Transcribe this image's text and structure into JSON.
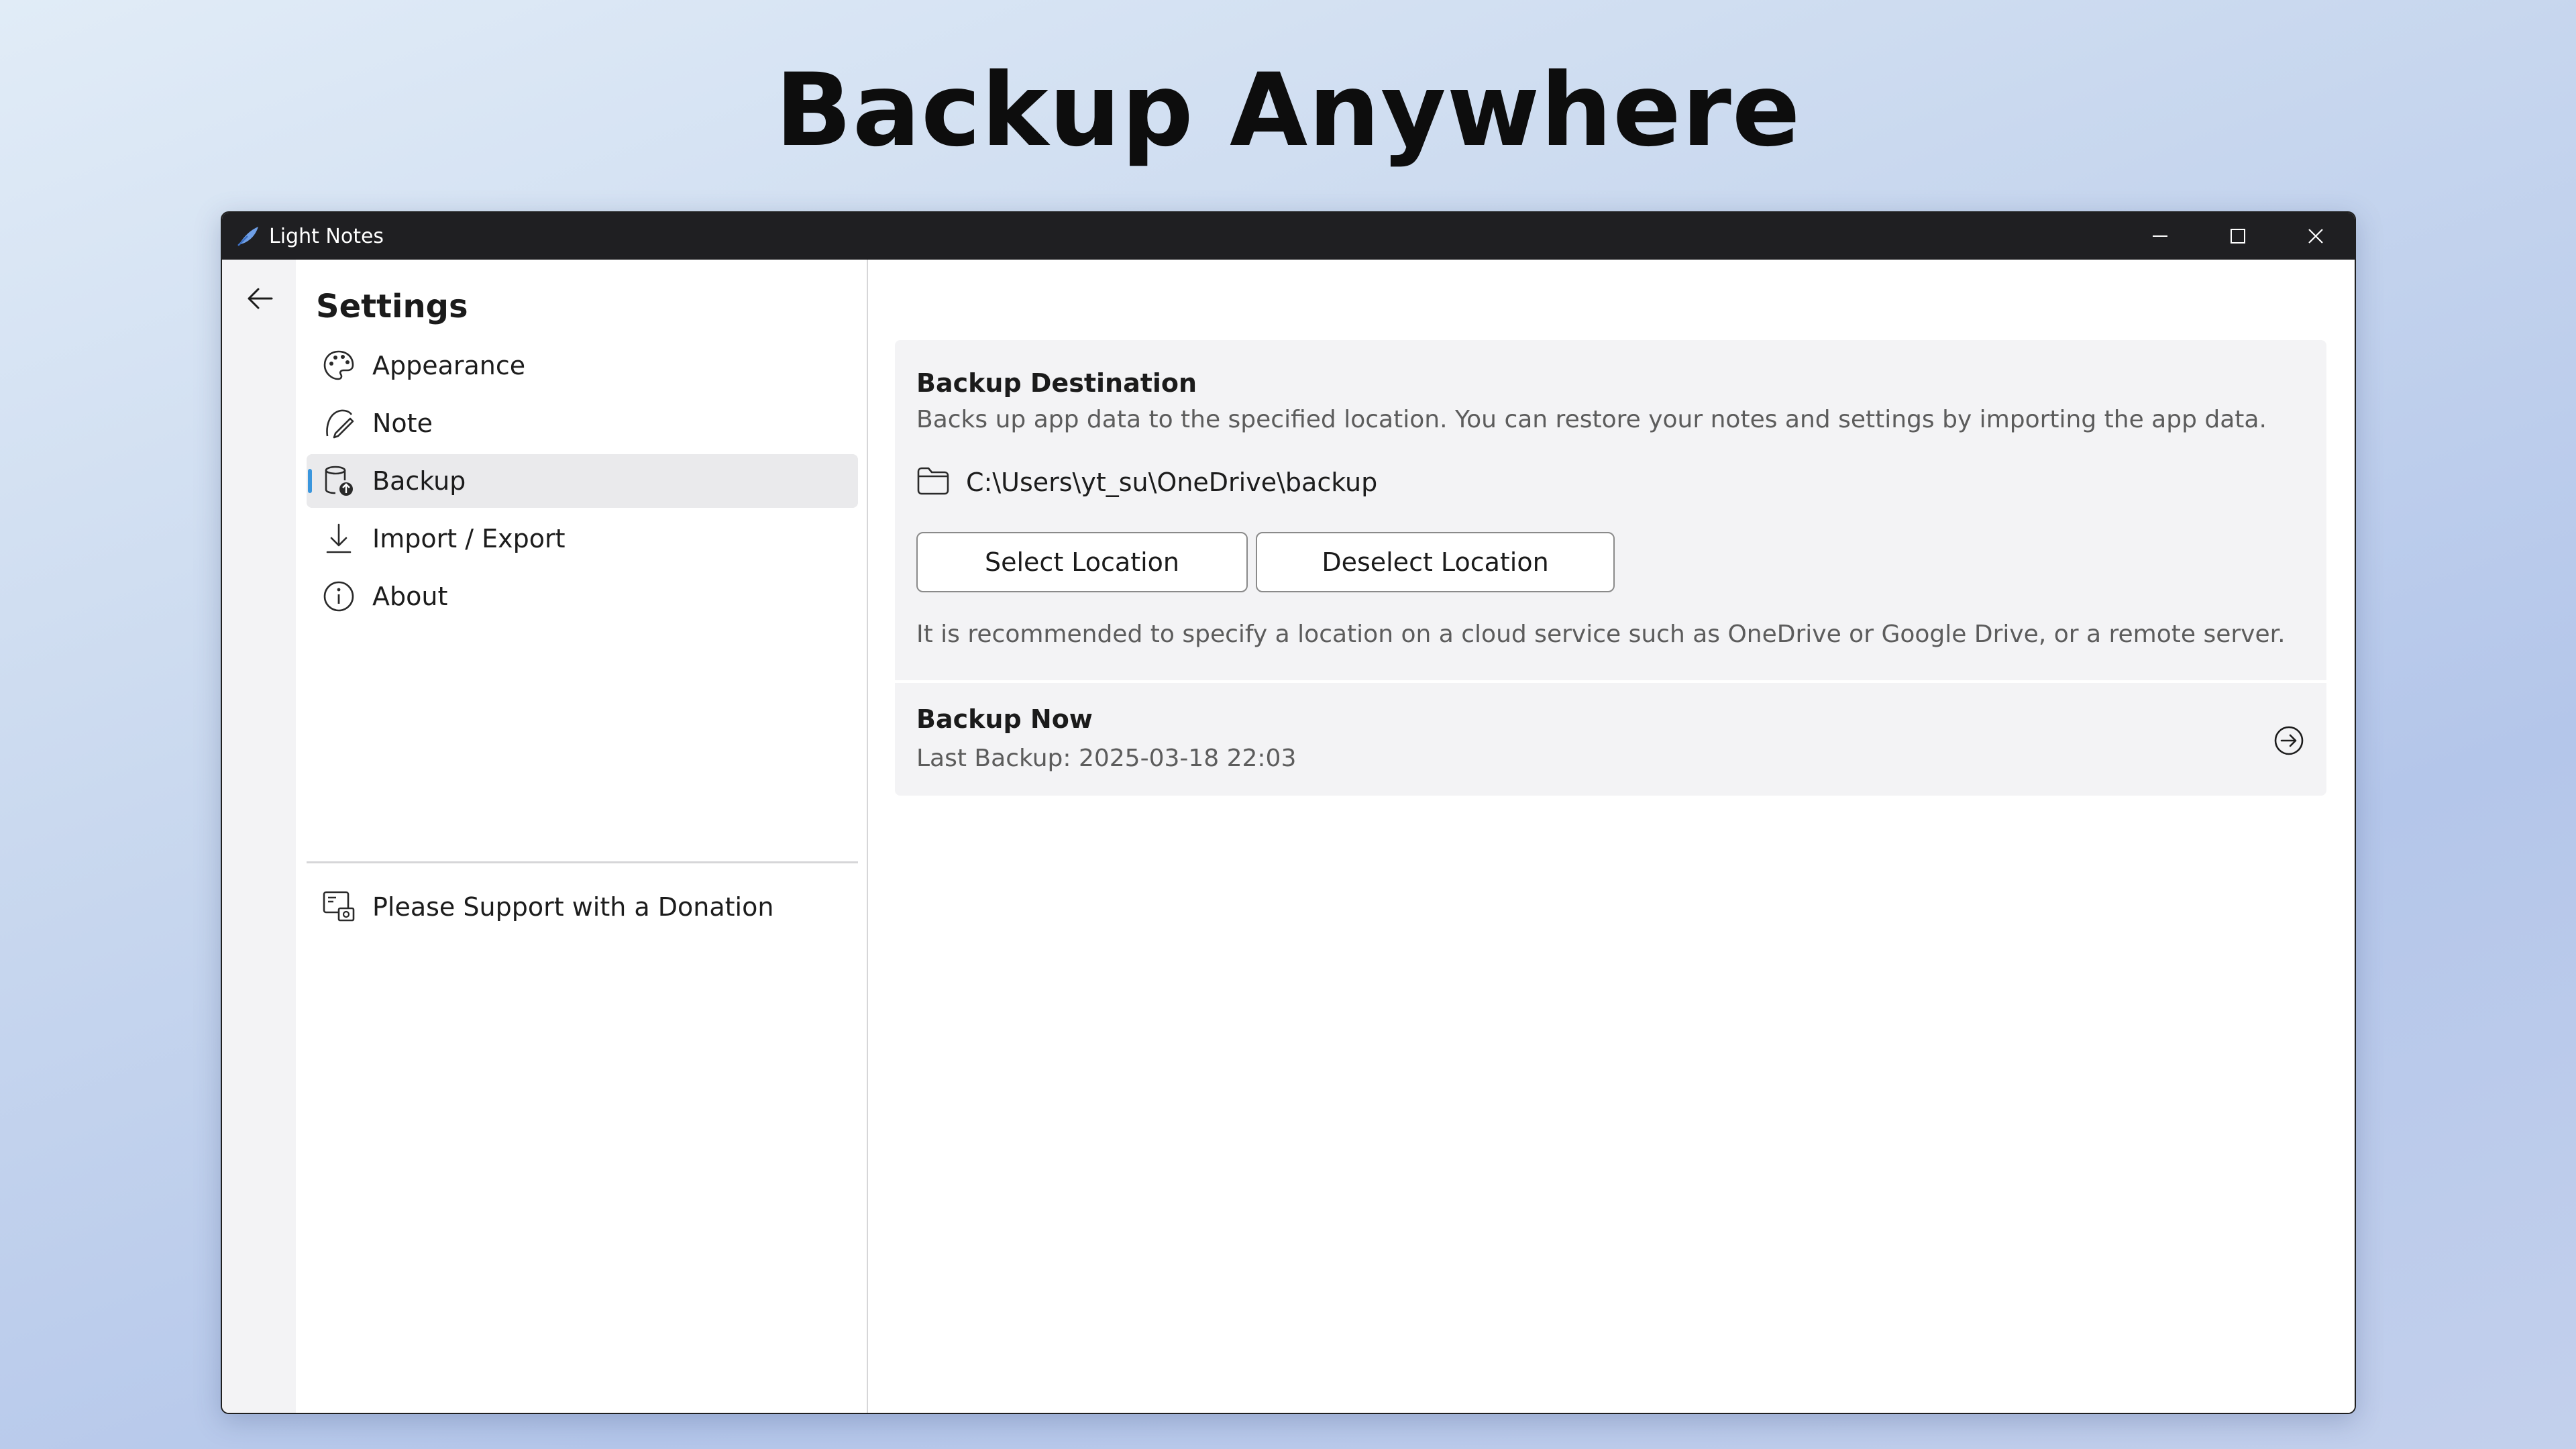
{
  "headline": "Backup Anywhere",
  "window": {
    "title": "Light Notes",
    "controls": {
      "minimize": "minimize-icon",
      "maximize": "maximize-icon",
      "close": "close-icon"
    }
  },
  "nav": {
    "title": "Settings",
    "items": [
      {
        "label": "Appearance",
        "icon": "palette-icon",
        "active": false
      },
      {
        "label": "Note",
        "icon": "note-edit-icon",
        "active": false
      },
      {
        "label": "Backup",
        "icon": "database-upload-icon",
        "active": true
      },
      {
        "label": "Import / Export",
        "icon": "download-icon",
        "active": false
      },
      {
        "label": "About",
        "icon": "info-icon",
        "active": false
      }
    ],
    "donation": {
      "label": "Please Support with a Donation",
      "icon": "donation-icon"
    }
  },
  "backup": {
    "destination": {
      "title": "Backup Destination",
      "description": "Backs up app data to the specified location. You can restore your notes and settings by importing the app data.",
      "path": "C:\\Users\\yt_su\\OneDrive\\backup",
      "select_label": "Select Location",
      "deselect_label": "Deselect Location",
      "hint": "It is recommended to specify a location on a cloud service such as OneDrive or Google Drive, or a remote server."
    },
    "now": {
      "title": "Backup Now",
      "last_backup": "Last Backup: 2025-03-18 22:03"
    }
  },
  "colors": {
    "accent": "#3a96dd",
    "titlebar": "#1f1f22",
    "card": "#f3f3f5"
  }
}
